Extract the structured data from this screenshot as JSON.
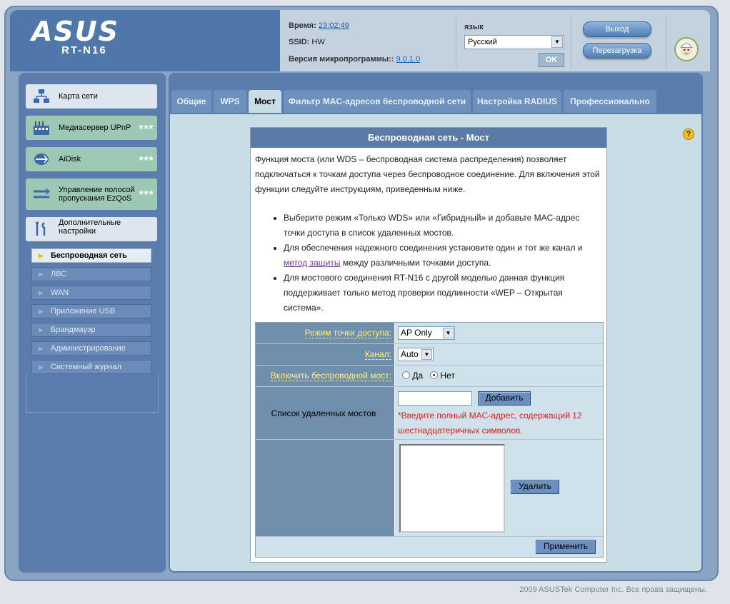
{
  "header": {
    "brand": "ASUS",
    "model": "RT-N16",
    "time_label": "Время:",
    "time_value": "23:02:49",
    "ssid_label": "SSID:",
    "ssid_value": "HW",
    "firmware_label": "Версия микропрограммы::",
    "firmware_value": "9.0.1.0",
    "language_label": "язык",
    "language_value": "Русский",
    "ok_label": "OK",
    "logout_label": "Выход",
    "reboot_label": "Перезагрузка"
  },
  "sidebar": {
    "items": [
      {
        "label": "Карта сети",
        "icon": "network-map-icon",
        "stars": ""
      },
      {
        "label": "Медиасервер UPnP",
        "icon": "media-server-icon",
        "stars": "★★★"
      },
      {
        "label": "AiDisk",
        "icon": "aidisk-icon",
        "stars": "★★★"
      },
      {
        "label": "Управление полосой пропускания EzQoS",
        "icon": "qos-icon",
        "stars": "★★★"
      },
      {
        "label": "Дополнительные настройки",
        "icon": "tools-icon",
        "stars": ""
      }
    ],
    "sub_items": [
      {
        "label": "Беспроводная сеть",
        "active": true
      },
      {
        "label": "ЛВС"
      },
      {
        "label": "WAN"
      },
      {
        "label": "Приложение USB"
      },
      {
        "label": "Брандмауэр"
      },
      {
        "label": "Администрирование"
      },
      {
        "label": "Системный журнал"
      }
    ]
  },
  "tabs": [
    {
      "label": "Общие"
    },
    {
      "label": "WPS"
    },
    {
      "label": "Мост",
      "active": true
    },
    {
      "label": "Фильтр MAC-адресов беспроводной сети"
    },
    {
      "label": "Настройка RADIUS"
    },
    {
      "label": "Профессионально"
    }
  ],
  "panel": {
    "title": "Беспроводная сеть - Мост",
    "intro": "Функция моста (или WDS – беспроводная система распределения) позволяет подключаться к точкам доступа через беспроводное соединение. Для включения этой функции следуйте инструкциям, приведенным ниже.",
    "bullet1": "Выберите режим «Только WDS» или «Гибридный» и добавьте MAC-адрес точки доступа в список удаленных мостов.",
    "bullet2_pre": "Для обеспечения надежного соединения установите один и тот же канал и ",
    "bullet2_link": "метод защиты",
    "bullet2_post": " между различными точками доступа.",
    "bullet3": "Для мостового соединения RT-N16 с другой моделью данная функция поддерживает только метод проверки подлинности «WEP – Открытая система».",
    "ap_mode_label": "Режим точки доступа:",
    "ap_mode_value": "AP Only",
    "channel_label": "Канал:",
    "channel_value": "Auto",
    "bridge_label": "Включить беспроводной мост:",
    "bridge_yes": "Да",
    "bridge_no": "Нет",
    "remote_list_label": "Список удаленных мостов",
    "add_label": "Добавить",
    "mac_hint": "*Введите полный MAC-адрес, содержащий 12 шестнадцатеричных символов.",
    "delete_label": "Удалить",
    "apply_label": "Применить"
  },
  "footer": {
    "copyright": "2009 ASUSTek Computer Inc. Все права защищены."
  },
  "colors": {
    "sidebar_bg": "#5b7dad",
    "panel_title_bg": "#5a7aa8",
    "label_text": "#ffef7a",
    "hint_text": "#e02020"
  }
}
